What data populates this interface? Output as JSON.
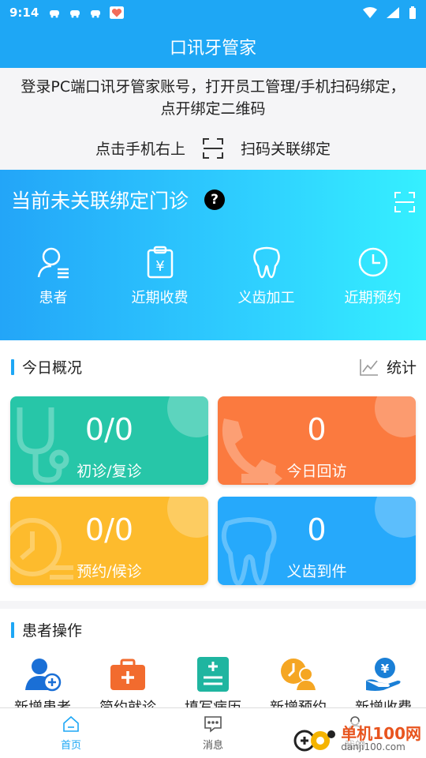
{
  "status": {
    "time": "9:14"
  },
  "header": {
    "title": "口讯牙管家"
  },
  "notice": {
    "instruction": "登录PC端口讯牙管家账号，打开员工管理/手机扫码绑定，点开绑定二维码",
    "tap_prefix": "点击手机右上",
    "tap_suffix": "扫码关联绑定"
  },
  "hero": {
    "title": "当前未关联绑定门诊",
    "help_mark": "?",
    "menu": [
      {
        "label": "患者",
        "icon": "patient-icon"
      },
      {
        "label": "近期收费",
        "icon": "fee-icon"
      },
      {
        "label": "义齿加工",
        "icon": "tooth-icon"
      },
      {
        "label": "近期预约",
        "icon": "clock-icon"
      }
    ]
  },
  "overview": {
    "title": "今日概况",
    "stats_label": "统计",
    "cards": [
      {
        "value": "0/0",
        "label": "初诊/复诊",
        "color": "#27c6a8"
      },
      {
        "value": "0",
        "label": "今日回访",
        "color": "#fb7a3f"
      },
      {
        "value": "0/0",
        "label": "预约/候诊",
        "color": "#fdbb2d"
      },
      {
        "value": "0",
        "label": "义齿到件",
        "color": "#26a9fb"
      }
    ]
  },
  "operations": {
    "title": "患者操作",
    "items": [
      {
        "label": "新增患者",
        "icon": "add-patient-icon"
      },
      {
        "label": "简约就诊",
        "icon": "medical-kit-icon"
      },
      {
        "label": "填写病历",
        "icon": "record-icon"
      },
      {
        "label": "新增预约",
        "icon": "appointment-icon"
      },
      {
        "label": "新增收费",
        "icon": "payment-icon"
      }
    ]
  },
  "tabs": [
    {
      "label": "首页",
      "icon": "home-icon"
    },
    {
      "label": "消息",
      "icon": "message-icon"
    },
    {
      "label": "我的",
      "icon": "profile-icon"
    }
  ],
  "watermark": {
    "brand": "单机100网",
    "url": "danji100.com"
  },
  "colors": {
    "primary": "#1ea7f5",
    "accent": "#1ea7f5"
  }
}
